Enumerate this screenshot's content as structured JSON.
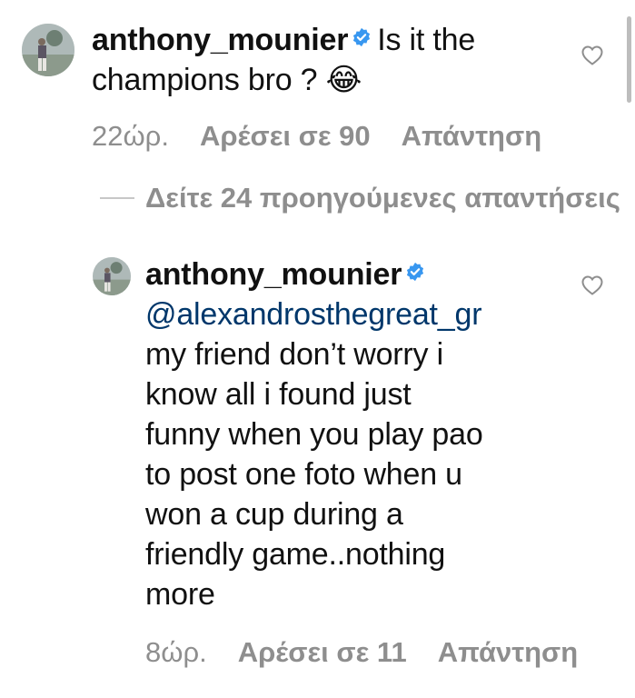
{
  "comment1": {
    "username": "anthony_mounier",
    "line1": "Is it the",
    "line2": "champions bro ? 😂",
    "time": "22ώρ.",
    "likes": "Αρέσει σε 90",
    "reply": "Απάντηση"
  },
  "view_replies": "Δείτε 24 προηγούμενες απαντήσεις",
  "comment2": {
    "username": "anthony_mounier",
    "mention": "@alexandrosthegreat_gr",
    "lines": [
      "my friend don’t worry i",
      "know all i found just",
      "funny when you play pao",
      "to post one foto when u",
      "won a cup during a",
      "friendly game..nothing",
      "more"
    ],
    "time": "8ώρ.",
    "likes": "Αρέσει σε 11",
    "reply": "Απάντηση"
  },
  "colors": {
    "text": "#111111",
    "meta": "#8e8e8e",
    "verified": "#3897f0",
    "mention": "#00376b"
  },
  "icons": [
    "verified-badge-icon",
    "heart-icon"
  ]
}
